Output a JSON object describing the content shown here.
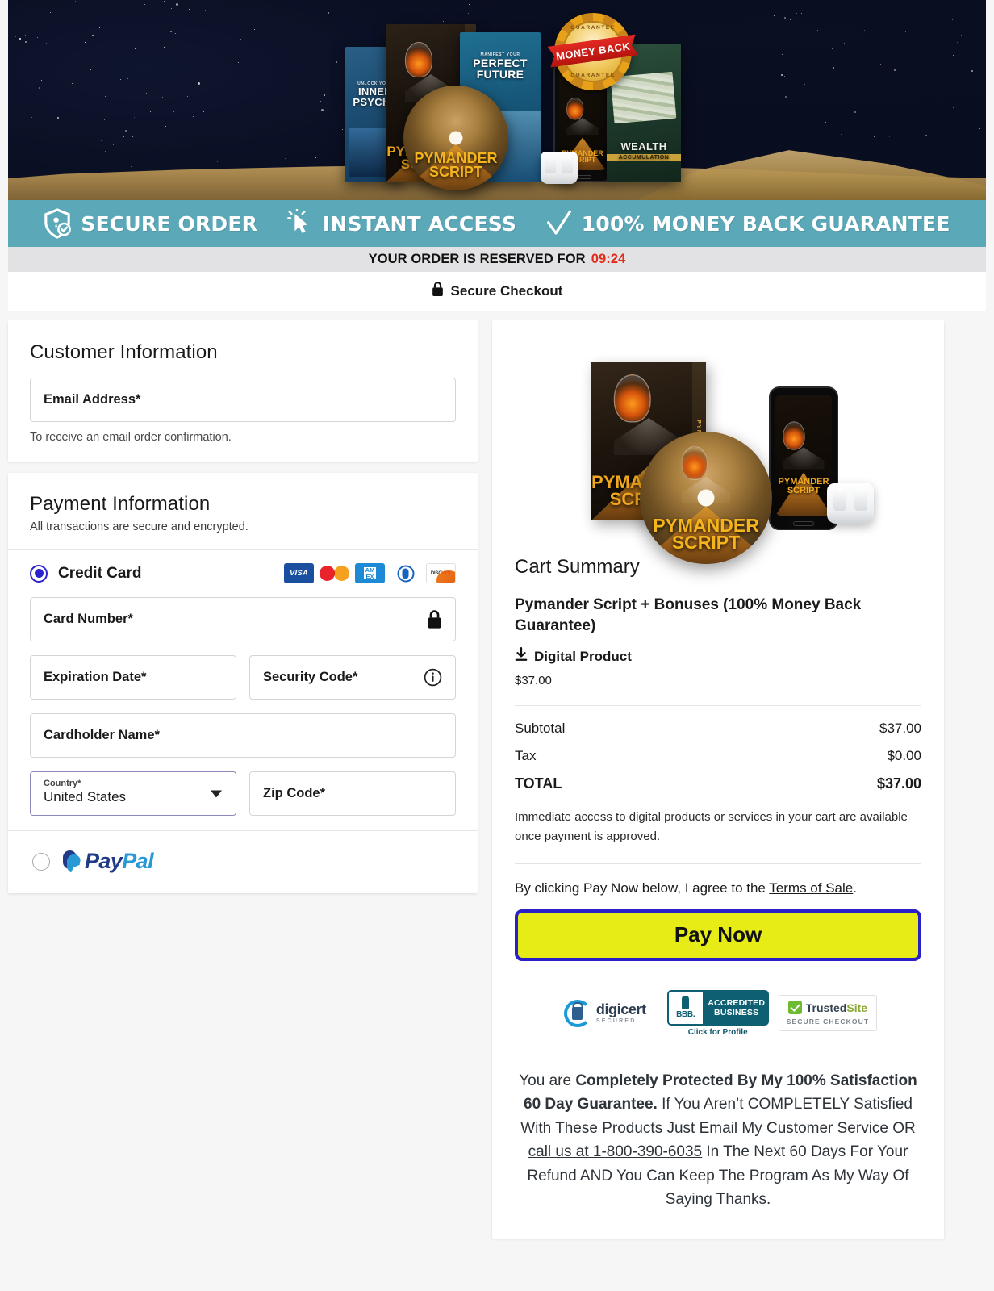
{
  "hero": {
    "money_back_seal": {
      "top_text": "GUARANTEE",
      "bottom_text": "GUARANTEE",
      "ribbon": "MONEY BACK"
    },
    "products": [
      {
        "name": "INNER PSYCHE",
        "kicker": "UNLOCK YOUR"
      },
      {
        "name": "PYMANDER SCRIPT",
        "spine": "PYMANDER"
      },
      {
        "name": "PERFECT FUTURE",
        "kicker": "MANIFEST YOUR"
      },
      {
        "name": "WEALTH",
        "sub": "ACCUMULATION"
      }
    ],
    "disc_label": "PYMANDER SCRIPT",
    "phone_label": "PYMANDER SCRIPT"
  },
  "trust_strip": {
    "items": [
      {
        "icon": "shield-check-icon",
        "label": "SECURE ORDER"
      },
      {
        "icon": "cursor-click-icon",
        "label": "INSTANT ACCESS"
      },
      {
        "icon": "checkmark-icon",
        "label": "100% MONEY BACK GUARANTEE"
      }
    ],
    "background_color": "#5ba8b8"
  },
  "timer": {
    "prefix": "YOUR ORDER IS RESERVED FOR",
    "time": "09:24",
    "time_color": "#e22b18",
    "background_color": "#e2e2e4"
  },
  "secure_checkout": {
    "icon": "lock-icon",
    "label": "Secure Checkout"
  },
  "customer_information": {
    "title": "Customer Information",
    "email_field": {
      "label": "Email Address*",
      "value": ""
    },
    "hint": "To receive an email order confirmation."
  },
  "payment_information": {
    "title": "Payment Information",
    "subtitle": "All transactions are secure and encrypted.",
    "methods": [
      {
        "id": "credit-card",
        "label": "Credit Card",
        "selected": true
      },
      {
        "id": "paypal",
        "label": "PayPal",
        "selected": false
      }
    ],
    "accepted_cards": [
      "VISA",
      "Mastercard",
      "AMEX",
      "Diners Club",
      "DISCOVER"
    ],
    "card_number": {
      "label": "Card Number*",
      "value": "",
      "icon": "lock-icon"
    },
    "expiration_date": {
      "label": "Expiration Date*",
      "value": ""
    },
    "security_code": {
      "label": "Security Code*",
      "value": "",
      "icon": "info-icon"
    },
    "cardholder_name": {
      "label": "Cardholder Name*",
      "value": ""
    },
    "country": {
      "label": "Country*",
      "value": "United States",
      "icon": "chevron-down-icon"
    },
    "zip_code": {
      "label": "Zip Code*",
      "value": ""
    },
    "paypal_label": {
      "a": "Pay",
      "b": "Pal"
    },
    "radio_color": "#2a22cc"
  },
  "cart": {
    "title": "Cart Summary",
    "item_name": "Pymander Script + Bonuses (100% Money Back Guarantee)",
    "item_type": "Digital Product",
    "item_type_icon": "download-icon",
    "item_price": "$37.00",
    "totals": [
      {
        "label": "Subtotal",
        "value": "$37.00",
        "bold": false
      },
      {
        "label": "Tax",
        "value": "$0.00",
        "bold": false
      },
      {
        "label": "TOTAL",
        "value": "$37.00",
        "bold": true
      }
    ],
    "access_note": "Immediate access to digital products or services in your cart are available once payment is approved.",
    "terms_prefix": "By clicking Pay Now below, I agree to the ",
    "terms_link": "Terms of Sale",
    "terms_suffix": ".",
    "pay_button": "Pay Now",
    "pay_button_bg": "#e8ec16",
    "pay_button_border": "#2a20c8"
  },
  "badges": [
    {
      "id": "digicert",
      "line1": "digicert",
      "line2": "SECURED"
    },
    {
      "id": "bbb",
      "line1": "BBB.",
      "line2": "ACCREDITED",
      "line3": "BUSINESS",
      "caption": "Click for Profile"
    },
    {
      "id": "trustedsite",
      "line1a": "Trusted",
      "line1b": "Site",
      "line2": "SECURE CHECKOUT"
    }
  ],
  "guarantee": {
    "p1": "You are ",
    "b1": "Completely Protected By My 100% Satisfaction 60 Day Guarantee.",
    "p2": " If You Aren’t COMPLETELY Satisfied With These Products Just ",
    "u1": "Email My Customer Service OR call us at 1-800-390-6035",
    "p3": " In The Next 60 Days For Your Refund AND You Can Keep The Program As My Way Of Saying Thanks."
  }
}
